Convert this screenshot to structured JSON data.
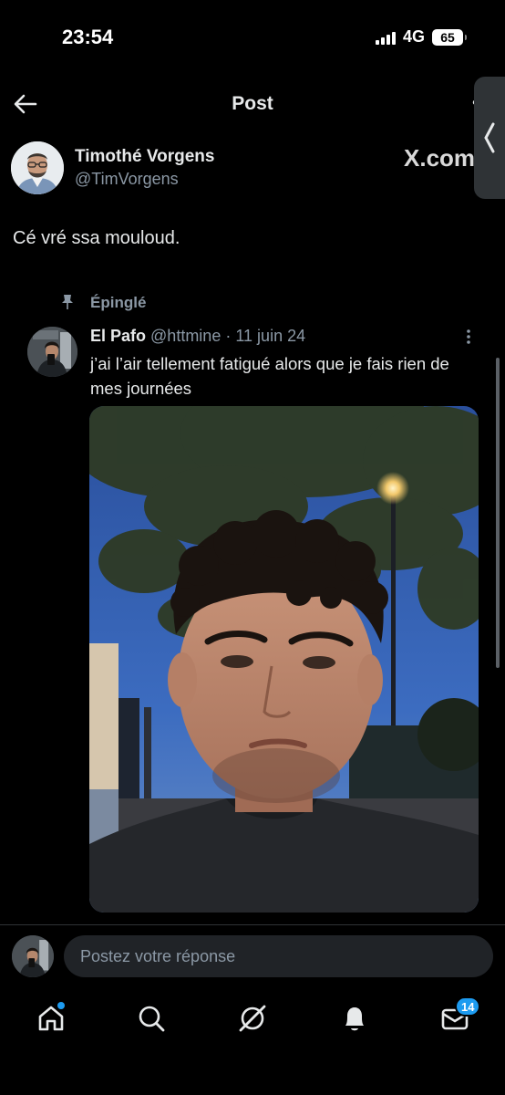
{
  "status_bar": {
    "time": "23:54",
    "network": "4G",
    "battery": "65"
  },
  "header": {
    "title": "Post"
  },
  "side_tab": {
    "icon": "chevron-left-icon"
  },
  "post": {
    "author_name": "Timothé Vorgens",
    "author_handle": "@TimVorgens",
    "watermark": "X.com",
    "text": "Cé vré ssa mouloud."
  },
  "quoted": {
    "pinned_label": "Épinglé",
    "name": "El Pafo",
    "handle": "@httmine",
    "separator": "·",
    "date": "11 juin 24",
    "text": "j’ai l’air tellement fatigué alors que je fais rien de mes journées"
  },
  "reply": {
    "placeholder": "Postez votre réponse"
  },
  "nav": {
    "items": [
      "home-icon",
      "search-icon",
      "grok-icon",
      "notifications-icon",
      "messages-icon"
    ],
    "messages_badge": "14",
    "accent": "#1d9bf0"
  },
  "colors": {
    "background": "#000000",
    "text": "#e7e9ea",
    "secondary": "#8b98a5",
    "accent": "#1d9bf0"
  }
}
